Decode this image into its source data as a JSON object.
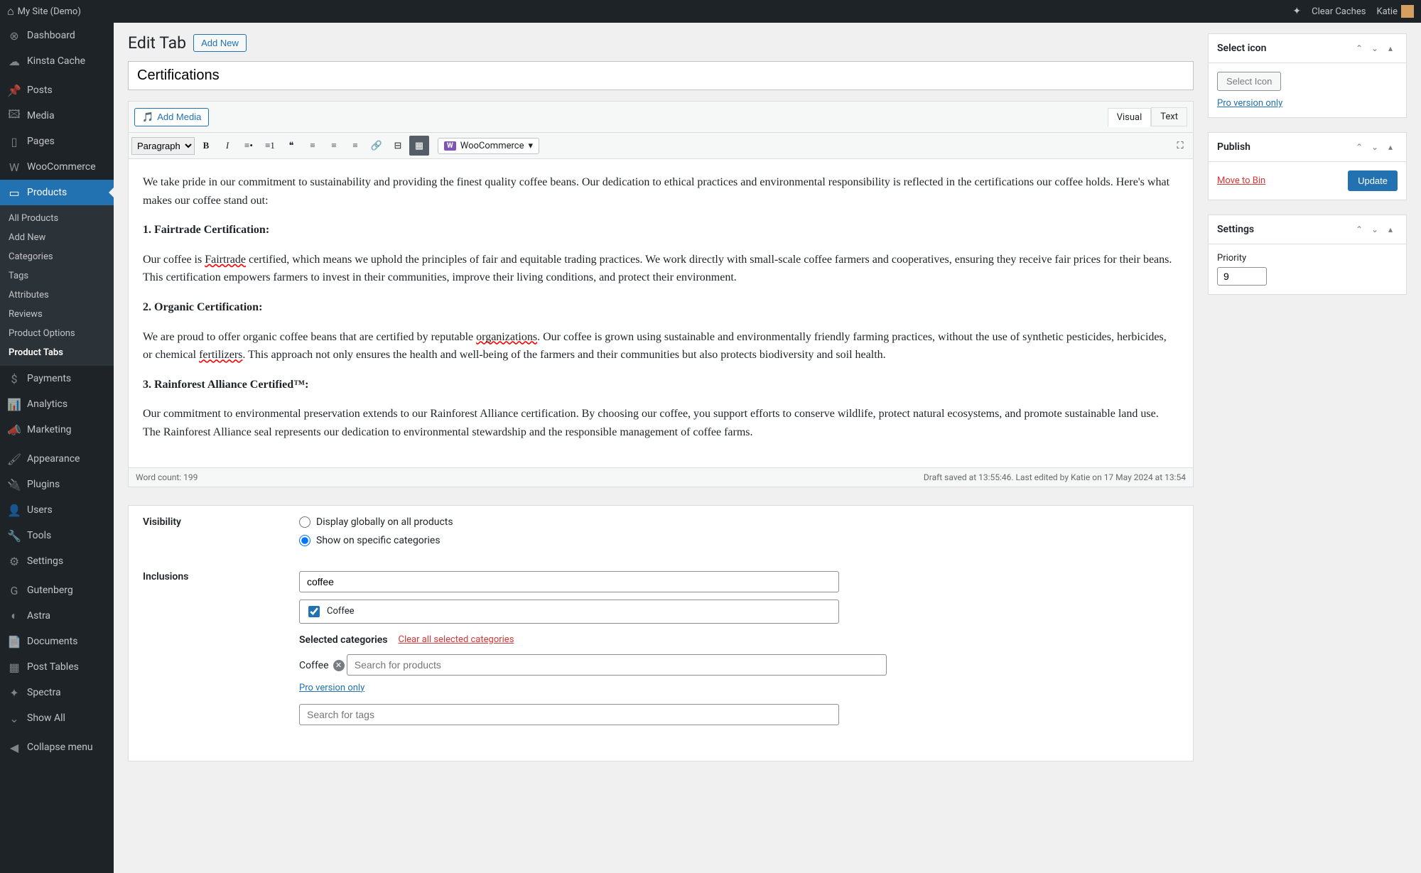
{
  "adminbar": {
    "site_name": "My Site (Demo)",
    "clear_caches": "Clear Caches",
    "user": "Katie"
  },
  "sidebar": {
    "items": [
      {
        "label": "Dashboard",
        "icon": "⊗"
      },
      {
        "label": "Kinsta Cache",
        "icon": "☁"
      },
      {
        "label": "Posts",
        "icon": "📌"
      },
      {
        "label": "Media",
        "icon": "🖾"
      },
      {
        "label": "Pages",
        "icon": "▯"
      },
      {
        "label": "WooCommerce",
        "icon": "W"
      },
      {
        "label": "Products",
        "icon": "▭",
        "active": true
      },
      {
        "label": "Payments",
        "icon": "$"
      },
      {
        "label": "Analytics",
        "icon": "📊"
      },
      {
        "label": "Marketing",
        "icon": "📣"
      },
      {
        "label": "Appearance",
        "icon": "🖌"
      },
      {
        "label": "Plugins",
        "icon": "🔌"
      },
      {
        "label": "Users",
        "icon": "👤"
      },
      {
        "label": "Tools",
        "icon": "🔧"
      },
      {
        "label": "Settings",
        "icon": "⚙"
      },
      {
        "label": "Gutenberg",
        "icon": "G"
      },
      {
        "label": "Astra",
        "icon": "◐"
      },
      {
        "label": "Documents",
        "icon": "📄"
      },
      {
        "label": "Post Tables",
        "icon": "▦"
      },
      {
        "label": "Spectra",
        "icon": "✦"
      },
      {
        "label": "Show All",
        "icon": "⌄"
      },
      {
        "label": "Collapse menu",
        "icon": "◀"
      }
    ],
    "submenu": [
      "All Products",
      "Add New",
      "Categories",
      "Tags",
      "Attributes",
      "Reviews",
      "Product Options",
      "Product Tabs"
    ],
    "submenu_current": "Product Tabs"
  },
  "page": {
    "heading": "Edit Tab",
    "add_new": "Add New",
    "title_value": "Certifications"
  },
  "editor": {
    "add_media": "Add Media",
    "tabs": {
      "visual": "Visual",
      "text": "Text"
    },
    "format_select": "Paragraph",
    "woo_btn": "WooCommerce",
    "content": {
      "p1": "We take pride in our commitment to sustainability and providing the finest quality coffee beans. Our dedication to ethical practices and environmental responsibility is reflected in the certifications our coffee holds. Here's what makes our coffee stand out:",
      "h1": "1. Fairtrade Certification:",
      "p2a": "Our coffee is ",
      "p2err": "Fairtrade",
      "p2b": " certified, which means we uphold the principles of fair and equitable trading practices. We work directly with small-scale coffee farmers and cooperatives, ensuring they receive fair prices for their beans. This certification empowers farmers to invest in their communities, improve their living conditions, and protect their environment.",
      "h2": "2. Organic Certification:",
      "p3a": "We are proud to offer organic coffee beans that are certified by reputable ",
      "p3err1": "organizations",
      "p3b": ". Our coffee is grown using sustainable and environmentally friendly farming practices, without the use of synthetic pesticides, herbicides, or chemical ",
      "p3err2": "fertilizers",
      "p3c": ". This approach not only ensures the health and well-being of the farmers and their communities but also protects biodiversity and soil health.",
      "h3": "3. Rainforest Alliance Certified™:",
      "p4": "Our commitment to environmental preservation extends to our Rainforest Alliance certification. By choosing our coffee, you support efforts to conserve wildlife, protect natural ecosystems, and promote sustainable land use. The Rainforest Alliance seal represents our dedication to environmental stewardship and the responsible management of coffee farms."
    },
    "word_count": "Word count: 199",
    "footer_right": "Draft saved at 13:55:46. Last edited by Katie on 17 May 2024 at 13:54"
  },
  "visibility": {
    "label": "Visibility",
    "opt_global": "Display globally on all products",
    "opt_specific": "Show on specific categories"
  },
  "inclusions": {
    "label": "Inclusions",
    "search_value": "coffee",
    "checkbox_label": "Coffee",
    "selected_label": "Selected categories",
    "clear_link": "Clear all selected categories",
    "chip": "Coffee",
    "search_products_ph": "Search for products",
    "pro_link": "Pro version only",
    "search_tags_ph": "Search for tags"
  },
  "sidebox": {
    "select_icon": {
      "title": "Select icon",
      "button": "Select Icon",
      "pro_link": "Pro version only"
    },
    "publish": {
      "title": "Publish",
      "trash": "Move to Bin",
      "update": "Update"
    },
    "settings": {
      "title": "Settings",
      "priority_label": "Priority",
      "priority_value": "9"
    }
  }
}
